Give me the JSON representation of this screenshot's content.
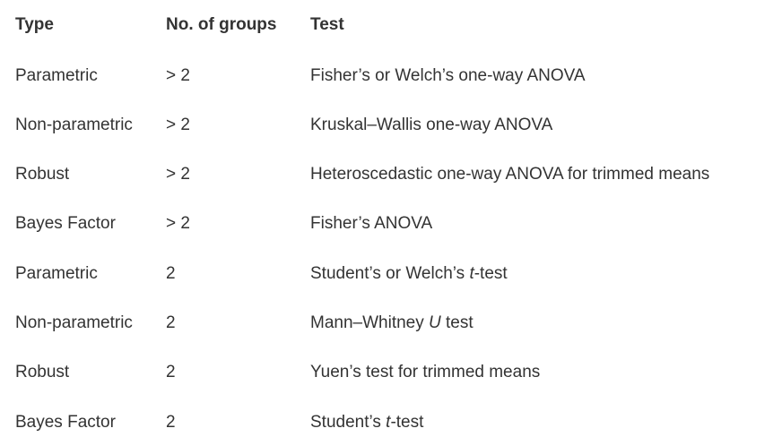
{
  "columns": {
    "type": "Type",
    "groups": "No. of groups",
    "test": "Test"
  },
  "rows": [
    {
      "type": "Parametric",
      "groups": "> 2",
      "test": "Fisher’s or Welch’s one-way ANOVA"
    },
    {
      "type": "Non-parametric",
      "groups": "> 2",
      "test": "Kruskal–Wallis one-way ANOVA"
    },
    {
      "type": "Robust",
      "groups": "> 2",
      "test": "Heteroscedastic one-way ANOVA for trimmed means"
    },
    {
      "type": "Bayes Factor",
      "groups": "> 2",
      "test": "Fisher’s ANOVA"
    },
    {
      "type": "Parametric",
      "groups": "2",
      "test_pre": "Student’s or Welch’s ",
      "test_em": "t",
      "test_post": "-test"
    },
    {
      "type": "Non-parametric",
      "groups": "2",
      "test_pre": "Mann–Whitney ",
      "test_em": "U",
      "test_post": " test"
    },
    {
      "type": "Robust",
      "groups": "2",
      "test": "Yuen’s test for trimmed means"
    },
    {
      "type": "Bayes Factor",
      "groups": "2",
      "test_pre": "Student’s ",
      "test_em": "t",
      "test_post": "-test"
    }
  ]
}
